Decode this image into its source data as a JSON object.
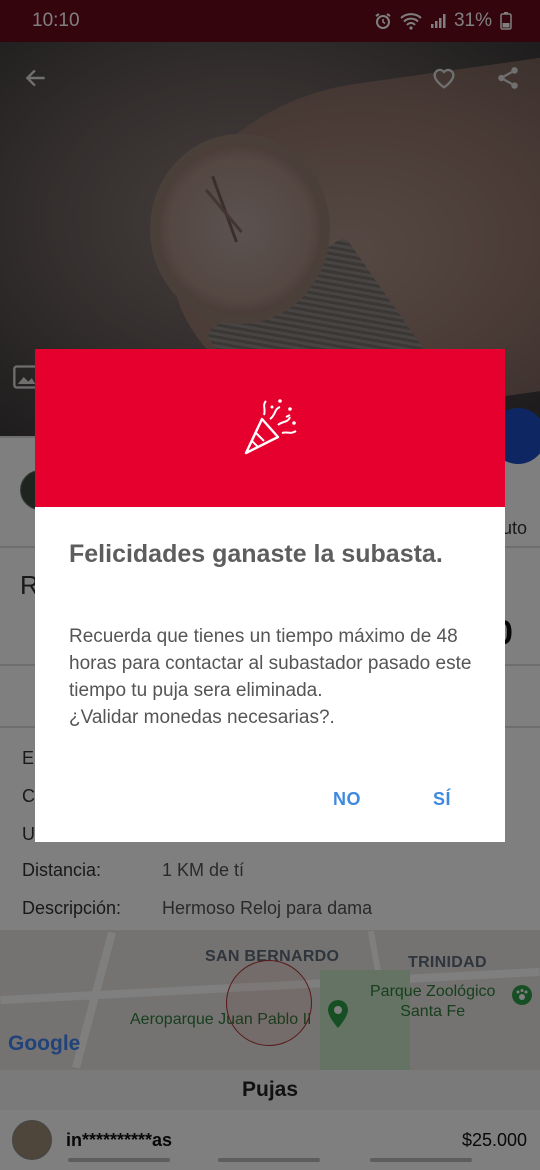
{
  "status_bar": {
    "time": "10:10",
    "battery": "31%",
    "icons": [
      "alarm-icon",
      "wifi-icon",
      "signal-icon",
      "battery-icon"
    ]
  },
  "toolbar": {
    "icons": [
      "back-arrow-icon",
      "heart-icon",
      "share-icon"
    ]
  },
  "listing": {
    "side_text_right": "uto",
    "title_initial": "R",
    "price_partial": "0",
    "details": [
      {
        "label": "E",
        "value": ""
      },
      {
        "label": "C",
        "value": ""
      },
      {
        "label": "U",
        "value": ""
      },
      {
        "label": "Distancia:",
        "value": "1 KM de tí"
      },
      {
        "label": "Descripción:",
        "value": "Hermoso Reloj para dama"
      }
    ]
  },
  "map": {
    "labels": [
      "SAN BERNARDO",
      "TRINIDAD"
    ],
    "places": [
      "Parque Zoológico\nSanta Fe",
      "Aeroparque Juan Pablo II"
    ],
    "attribution": "Google"
  },
  "bids": {
    "header": "Pujas",
    "items": [
      {
        "user": "in**********as",
        "amount": "$25.000"
      }
    ]
  },
  "dialog": {
    "title": "Felicidades ganaste la subasta.",
    "message": "Recuerda que tienes un tiempo máximo de 48 horas para contactar al subastador pasado este tiempo tu puja sera eliminada.\n¿Validar monedas necesarias?.",
    "no_label": "NO",
    "yes_label": "SÍ",
    "header_color": "#e6002d",
    "icon": "party-popper-icon"
  }
}
